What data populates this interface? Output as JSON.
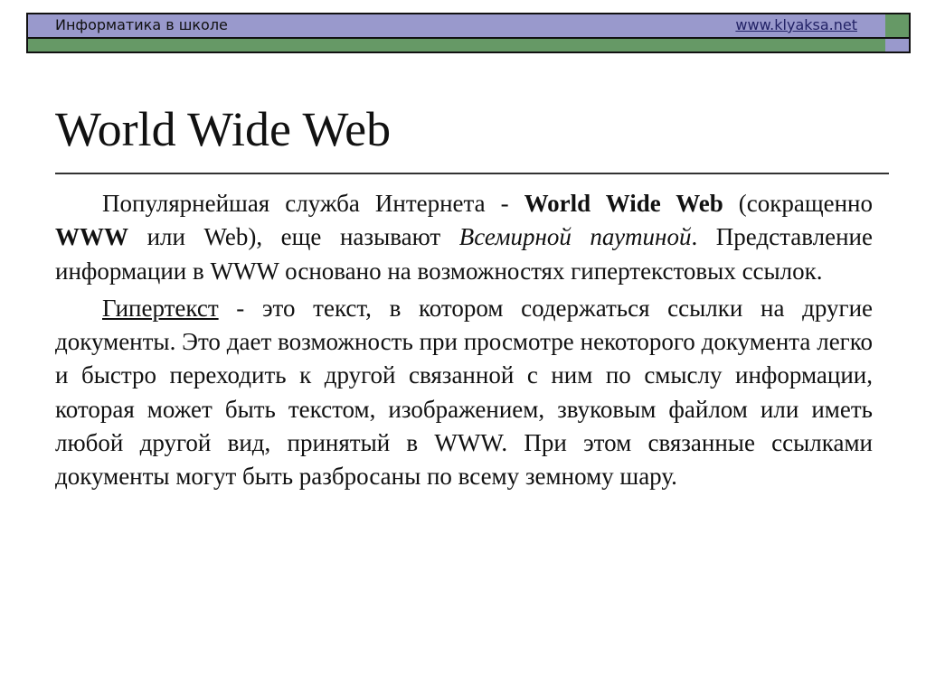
{
  "header": {
    "title": "Информатика в школе",
    "link": "www.klyaksa.net"
  },
  "slide": {
    "title": "World Wide Web",
    "p1": {
      "a": "Популярнейшая служба Интернета - ",
      "b": "World Wide Web",
      "c": " (сокращенно ",
      "d": "WWW",
      "e": " или Web), еще называют ",
      "f": "Всемирной паутиной",
      "g": ". Представление информации в WWW основано на возможностях гипертекстовых ссылок."
    },
    "p2": {
      "term": "Гипертекст",
      "rest": " - это текст, в котором содержаться ссылки на другие документы. Это дает возможность при просмотре некоторого документа легко и быстро переходить к другой связанной с ним по смыслу информации, которая может быть текстом, изображением, звуковым файлом или иметь любой другой вид, принятый в WWW. При этом связанные ссылками документы могут быть разбросаны по всему земному шару."
    }
  }
}
